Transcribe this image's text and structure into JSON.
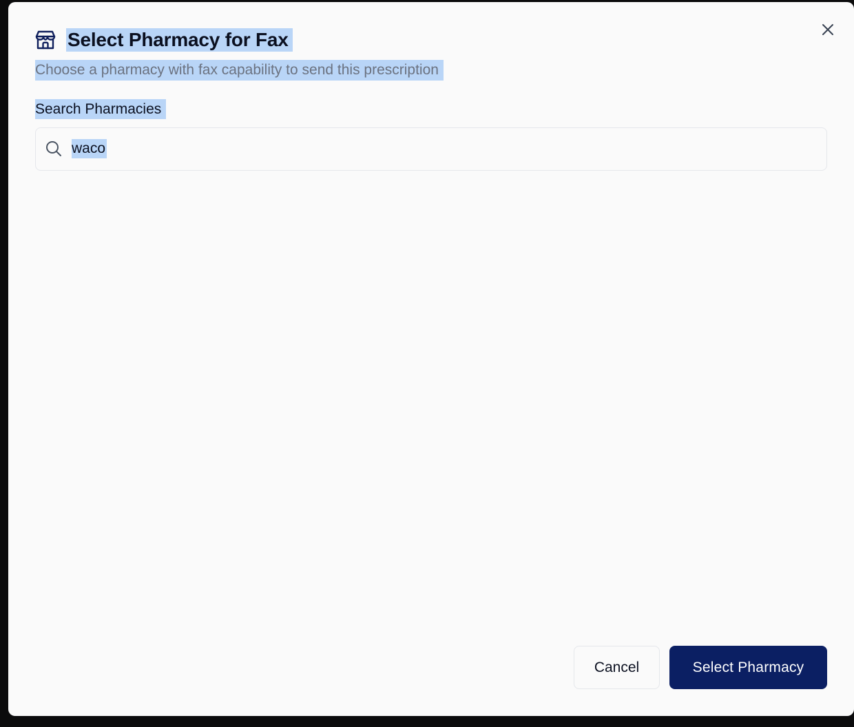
{
  "dialog": {
    "title": "Select Pharmacy for Fax",
    "subtitle": "Choose a pharmacy with fax capability to send this prescription",
    "title_icon": "store-icon",
    "close_icon": "close-icon"
  },
  "search": {
    "label": "Search Pharmacies",
    "value": "waco",
    "icon": "search-icon"
  },
  "actions": {
    "cancel_label": "Cancel",
    "confirm_label": "Select Pharmacy"
  },
  "colors": {
    "primary": "#0b1f63",
    "selection_highlight": "#b9d5f7",
    "muted_text": "#6b7280",
    "dialog_bg": "#fafafa"
  }
}
